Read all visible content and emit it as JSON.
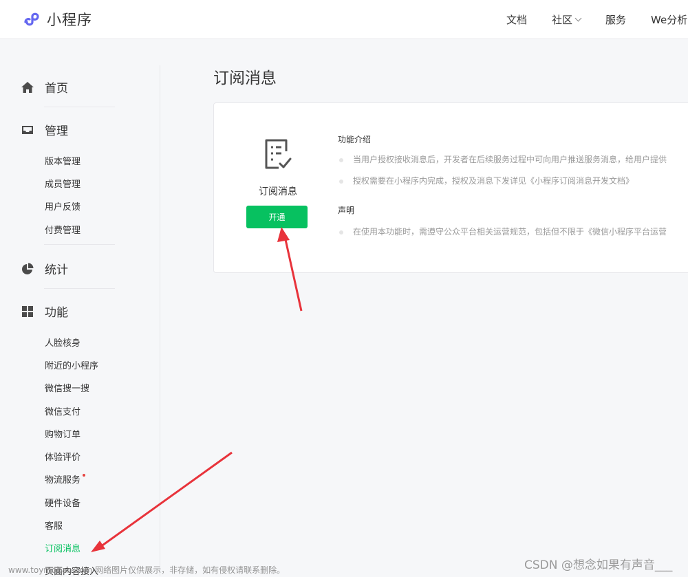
{
  "app": {
    "title": "小程序"
  },
  "topnav": {
    "items": [
      "文档",
      "社区",
      "服务",
      "We分析"
    ]
  },
  "sidebar": {
    "groups": [
      {
        "label": "首页",
        "icon": "home-icon"
      },
      {
        "label": "管理",
        "icon": "inbox-icon"
      },
      {
        "label": "统计",
        "icon": "pie-chart-icon"
      },
      {
        "label": "功能",
        "icon": "grid-icon"
      }
    ],
    "manage_items": [
      "版本管理",
      "成员管理",
      "用户反馈",
      "付费管理"
    ],
    "feature_items": [
      "人脸核身",
      "附近的小程序",
      "微信搜一搜",
      "微信支付",
      "购物订单",
      "体验评价",
      "物流服务",
      "硬件设备",
      "客服",
      "订阅消息",
      "页面内容接入"
    ],
    "active_item": "订阅消息"
  },
  "main": {
    "title": "订阅消息",
    "card": {
      "feature_name": "订阅消息",
      "icon": "document-check-icon",
      "open_button": "开通",
      "intro_title": "功能介绍",
      "intro_bullets": [
        "当用户授权接收消息后，开发者在后续服务过程中可向用户推送服务消息，给用户提供",
        "授权需要在小程序内完成，授权及消息下发详见《小程序订阅消息开发文档》"
      ],
      "statement_title": "声明",
      "statement_bullets": [
        "在使用本功能时，需遵守公众平台相关运营规范，包括但不限于《微信小程序平台运营"
      ]
    }
  },
  "watermark": {
    "left": "www.toymoban.com 网络图片仅供展示，非存储，如有侵权请联系删除。",
    "right": "CSDN @想念如果有声音___"
  },
  "colors": {
    "accent_green": "#07c160",
    "annotation_red": "#e8333b",
    "page_bg": "#f6f7f9"
  }
}
